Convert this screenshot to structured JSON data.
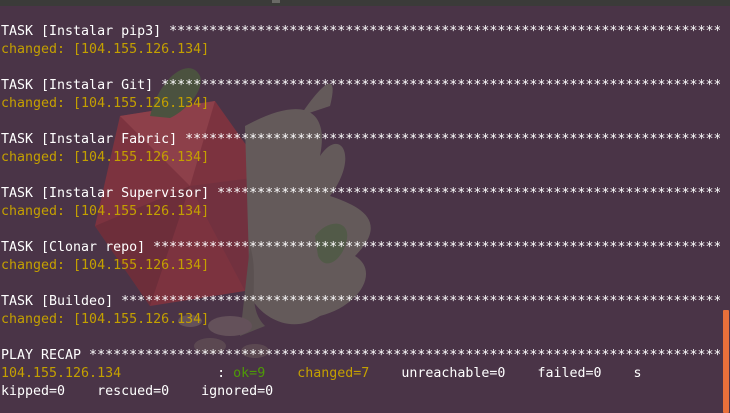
{
  "tasks": [
    {
      "header": "TASK [Instalar pip3] *************************************************************************",
      "result": "changed: [104.155.126.134]"
    },
    {
      "header": "TASK [Instalar Git] **************************************************************************",
      "result": "changed: [104.155.126.134]"
    },
    {
      "header": "TASK [Instalar Fabric] ***********************************************************************",
      "result": "changed: [104.155.126.134]"
    },
    {
      "header": "TASK [Instalar Supervisor] *******************************************************************",
      "result": "changed: [104.155.126.134]"
    },
    {
      "header": "TASK [Clonar repo] ***************************************************************************",
      "result": "changed: [104.155.126.134]"
    },
    {
      "header": "TASK [Buildeo] *******************************************************************************",
      "result": "changed: [104.155.126.134]"
    }
  ],
  "recap": {
    "header": "PLAY RECAP *******************************************************************************",
    "host": "104.155.126.134",
    "sep": "            : ",
    "ok": "ok=9",
    "changed": "changed=7",
    "unreachable": "unreachable=0",
    "failed": "failed=0",
    "wrap_tail": "s",
    "line2": "kipped=0    rescued=0    ignored=0"
  },
  "colors": {
    "background": "#4a3447",
    "changed": "#c4a000",
    "ok": "#4e9a06",
    "scroll_thumb": "#e8703a"
  }
}
